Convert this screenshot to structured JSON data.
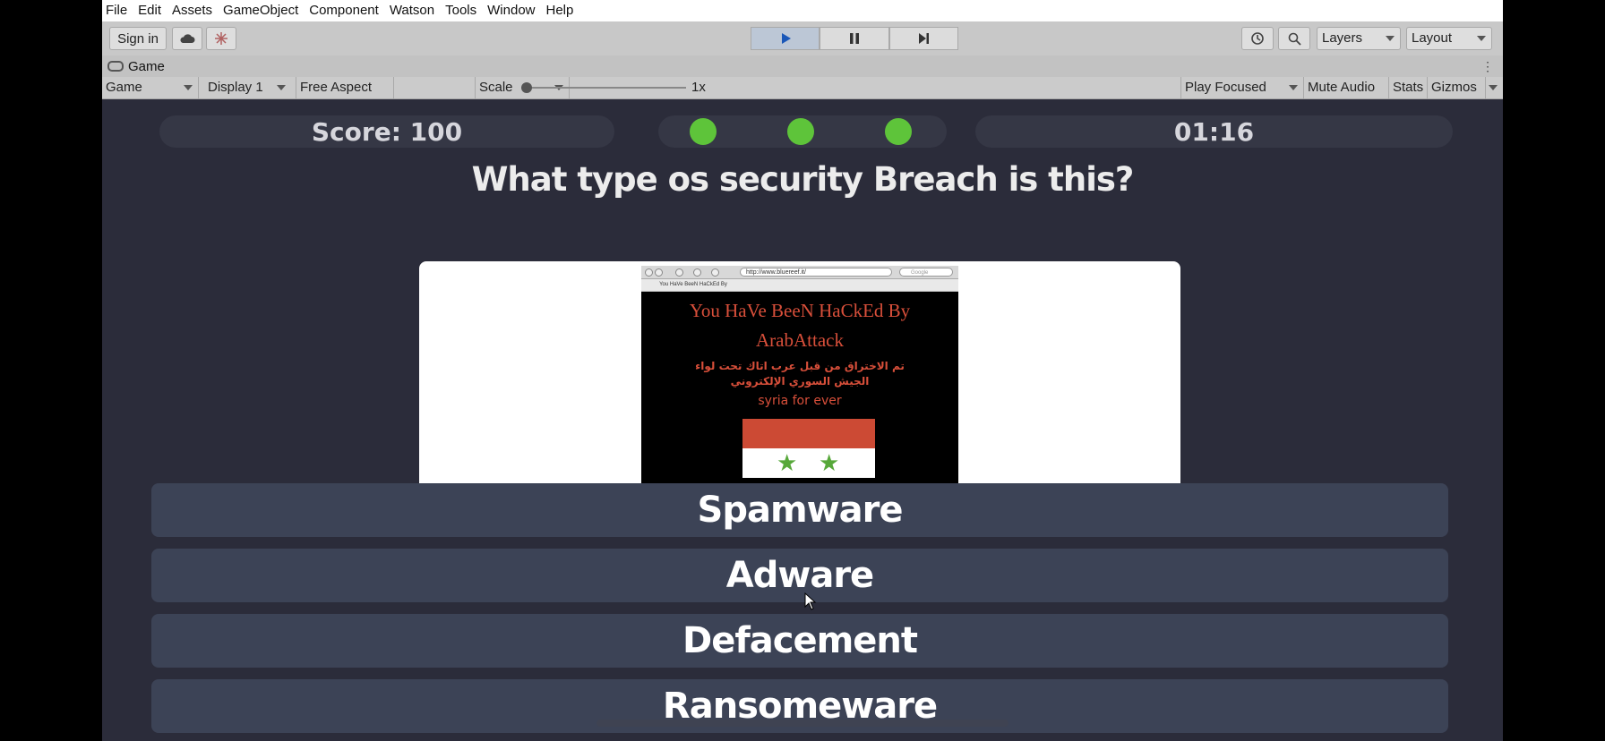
{
  "menubar": {
    "items": [
      "File",
      "Edit",
      "Assets",
      "GameObject",
      "Component",
      "Watson",
      "Tools",
      "Window",
      "Help"
    ]
  },
  "toolbar": {
    "sign_in_label": "Sign in",
    "cloud_icon": "cloud-icon",
    "collab_icon": "collab-icon",
    "play_icon": "play-icon",
    "pause_icon": "pause-icon",
    "step_icon": "step-icon",
    "history_icon": "history-icon",
    "search_icon": "search-icon",
    "layers_label": "Layers",
    "layout_label": "Layout"
  },
  "game_tab": {
    "label": "Game"
  },
  "game_view_toolbar": {
    "view_dropdown": "Game",
    "display_dropdown": "Display 1",
    "aspect_dropdown": "Free Aspect",
    "scale_label": "Scale",
    "scale_value": "1x",
    "play_mode_dropdown": "Play Focused",
    "mute_audio_label": "Mute Audio",
    "stats_label": "Stats",
    "gizmos_label": "Gizmos"
  },
  "hud": {
    "score_text": "Score: 100",
    "lives_remaining": 3,
    "timer": "01:16"
  },
  "question": "What type os security Breach is this?",
  "image": {
    "url_text": "http://www.bluereef.it/",
    "search_placeholder": "Google",
    "tab_title": "You HaVe BeeN HaCkEd By",
    "headline_line1": "You HaVe BeeN HaCkEd By",
    "headline_line2": "ArabAttack",
    "arabic_text": "تم  الاختراق من قبل عرب اتاك تحت لواء الجيش السوري الإلكتروني",
    "tagline": "syria for ever",
    "flag_colors": {
      "top": "#cc4a34",
      "middle": "#ffffff",
      "star": "#57a83a"
    }
  },
  "answers": [
    {
      "label": "Spamware"
    },
    {
      "label": "Adware"
    },
    {
      "label": "Defacement"
    },
    {
      "label": "Ransomeware"
    }
  ],
  "colors": {
    "background": "#2b2c3a",
    "hud_pill": "#353745",
    "answer_button": "#3c4356",
    "life_dot": "#5ec43a"
  }
}
